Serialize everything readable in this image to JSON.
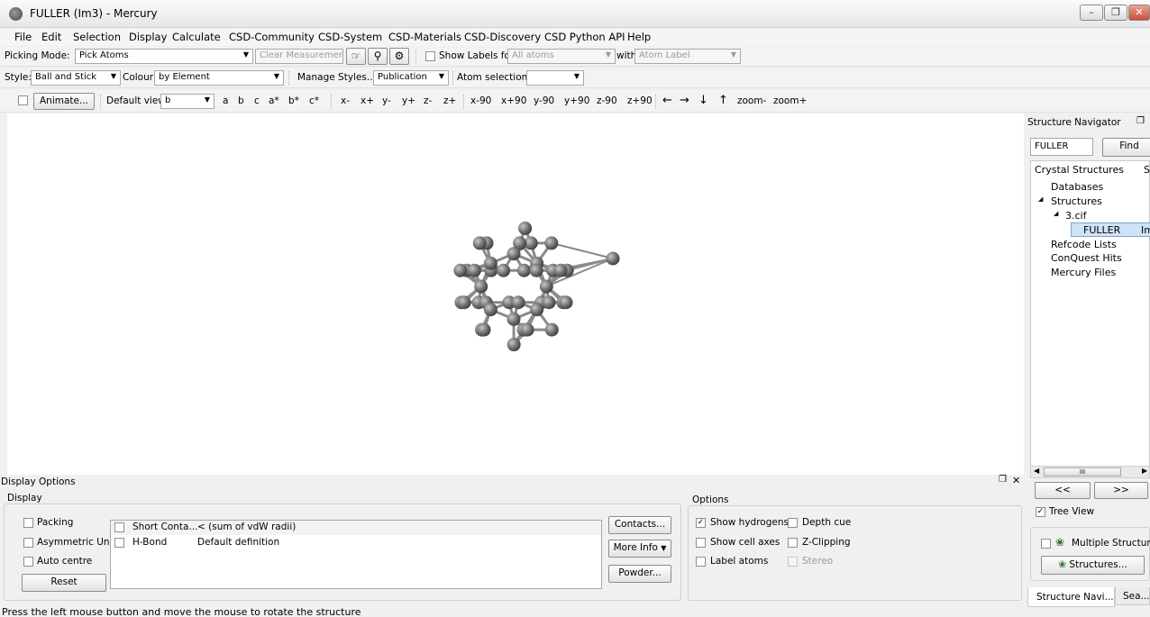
{
  "window": {
    "title": "FULLER (Im3) - Mercury"
  },
  "menu": [
    "File",
    "Edit",
    "Selection",
    "Display",
    "Calculate",
    "CSD-Community",
    "CSD-System",
    "CSD-Materials",
    "CSD-Discovery",
    "CSD Python API",
    "Help"
  ],
  "toolbar1": {
    "picking_label": "Picking Mode:",
    "picking_value": "Pick Atoms",
    "clear_measurements": "Clear Measurements",
    "show_labels_for": "Show Labels for",
    "labels_value": "All atoms",
    "with_label": "with",
    "with_value": "Atom Label"
  },
  "toolbar2": {
    "style_label": "Style:",
    "style_value": "Ball and Stick",
    "colour_label": "Colour:",
    "colour_value": "by Element",
    "manage_styles": "Manage Styles...",
    "publication": "Publication",
    "atom_selections": "Atom selections:"
  },
  "toolbar3": {
    "animate": "Animate...",
    "default_view_label": "Default view:",
    "default_view_value": "b",
    "views": [
      "a",
      "b",
      "c",
      "a*",
      "b*",
      "c*",
      "x-",
      "x+",
      "y-",
      "y+",
      "z-",
      "z+",
      "x-90",
      "x+90",
      "y-90",
      "y+90",
      "z-90",
      "z+90",
      "←",
      "→",
      "↓",
      "↑",
      "zoom-",
      "zoom+"
    ]
  },
  "navigator": {
    "title": "Structure Navigator",
    "search_value": "FULLER",
    "find": "Find",
    "header": "Crystal Structures",
    "header2": "S",
    "databases": "Databases",
    "structures": "Structures",
    "file": "3.cif",
    "entry": "FULLER",
    "entry_sg": "Im",
    "refcode_lists": "Refcode Lists",
    "conquest_hits": "ConQuest Hits",
    "mercury_files": "Mercury Files",
    "scroll_grip": "III",
    "prev": "<<",
    "next": ">>",
    "tree_view": "Tree View",
    "multiple_structures": "Multiple Structures",
    "structures_btn": "Structures...",
    "tab1": "Structure Navi...",
    "tab2": "Sea..."
  },
  "display_options": {
    "title": "Display Options",
    "display_group": "Display",
    "packing": "Packing",
    "asymmetric_unit": "Asymmetric Unit",
    "auto_centre": "Auto centre",
    "reset": "Reset",
    "contacts": [
      {
        "name": "Short Conta...",
        "definition": "< (sum of vdW radii)"
      },
      {
        "name": "H-Bond",
        "definition": "Default definition"
      }
    ],
    "contacts_btn": "Contacts...",
    "more_info_btn": "More Info",
    "powder_btn": "Powder...",
    "options_group": "Options",
    "show_hydrogens": "Show hydrogens",
    "depth_cue": "Depth cue",
    "show_cell_axes": "Show cell axes",
    "z_clipping": "Z-Clipping",
    "label_atoms": "Label atoms",
    "stereo": "Stereo"
  },
  "status": "Press the left mouse button and move the mouse to rotate the structure",
  "colors": {
    "atom": "#6e6e6e",
    "bond": "#8a8a8a",
    "highlight": "#cfe3f7"
  }
}
